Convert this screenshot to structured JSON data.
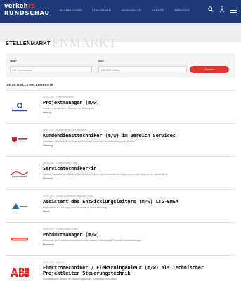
{
  "header": {
    "logo_line1": "verkehrs",
    "logo_line1_accent": "rs",
    "logo_line2": "RUNDSCHAU",
    "nav": [
      "Nachrichten",
      "Für Firmen",
      "Regionales",
      "Events",
      "Services"
    ],
    "search_icon": "search-icon",
    "user_icon": "user-icon",
    "menu_icon": "menu-icon"
  },
  "page": {
    "title_bold": "STELLENMARKT",
    "title_faded": "ENMARKT"
  },
  "search": {
    "what_label": "Was?",
    "what_value": "z.B. Informatiker/in",
    "where_label": "Wo?",
    "where_value": "z.B. Ort/PLZ/Land",
    "button_label": "Suchen"
  },
  "list": {
    "section_title": "Die aktuellsten Angebote",
    "jobs": [
      {
        "meta": "20.03.2017 · Unternehmen AG",
        "title": "Projektmanager (m/w)",
        "desc": "Planen von Projekten in Rahmen von Zielvorgaben",
        "location": "Autberg",
        "logo": "Company A"
      },
      {
        "meta": "20.03.2017 · Kundendienst Service GmbH",
        "title": "Kundendiensttechniker (m/w) im Bereich Services",
        "desc": "Installation Inbetriebnahme Reparatur Wartung Umbau und Troubleshooting beim Kunden",
        "location": "Hamburg",
        "logo": "Company B"
      },
      {
        "meta": "20.03.2017 · Unternehmen GmbH",
        "title": "Servicetechniker/in",
        "desc": "Wartung Reparatur und Sicherheitsprüfung von elektro- und mechanischen Komponenten und Systemen im Kundendienst",
        "location": "München",
        "logo": "Company C"
      },
      {
        "meta": "20.03.2017 · LAMM Unternehmensgruppe GmbH",
        "title": "Assistent des Entwicklungsleiters (m/w) LTG-EMEA",
        "desc": "Organisation von Meetings und Dienstreisen, Protokollführung",
        "location": "Neuss",
        "logo": "Company D"
      },
      {
        "meta": "20.03.2017 · Unternehmen GmbH",
        "title": "Produktmanager (m/w)",
        "desc": "Betreuung von Produktverantwortlichen und anderen Portfolios und Produkte Neuentwicklungen",
        "location": "Feuerwerk",
        "logo": "Company E"
      },
      {
        "meta": "20.03.2017 · ABB AG",
        "title": "Elektrotechniker / Elektroingenieur (m/w) als Technischer",
        "title2": "Projektleiter Steuerungstechnik",
        "desc": "Koordination im Bereich der Steuerungstechnik, Konzeption und Aufbau",
        "location": "Mannheim",
        "logo": "ABB"
      }
    ]
  },
  "colors": {
    "header_bg": "#1e3a7b",
    "accent_red": "#e3342f",
    "abb_red": "#e2231a"
  }
}
